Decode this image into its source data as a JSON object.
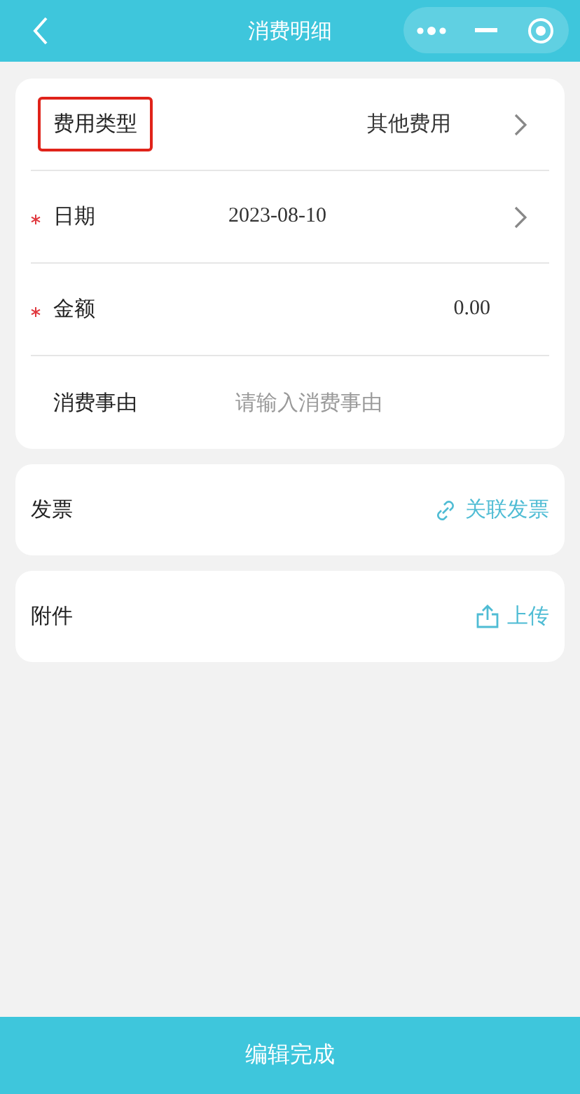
{
  "header": {
    "title": "消费明细"
  },
  "fields": [
    {
      "kind": "select",
      "label": "费用类型",
      "value": "其他费用",
      "required": false,
      "highlighted": true
    },
    {
      "kind": "date",
      "label": "日期",
      "value": "2023-08-10",
      "required": true,
      "highlighted": false
    },
    {
      "kind": "amount",
      "label": "金额",
      "value": "0.00",
      "required": true,
      "highlighted": false
    },
    {
      "kind": "input",
      "label": "消费事由",
      "placeholder": "请输入消费事由",
      "required": false,
      "highlighted": false
    }
  ],
  "sections": [
    {
      "kind": "link",
      "label": "发票",
      "action": "关联发票"
    },
    {
      "kind": "upload",
      "label": "附件",
      "action": "上传"
    }
  ],
  "submit": "编辑完成"
}
